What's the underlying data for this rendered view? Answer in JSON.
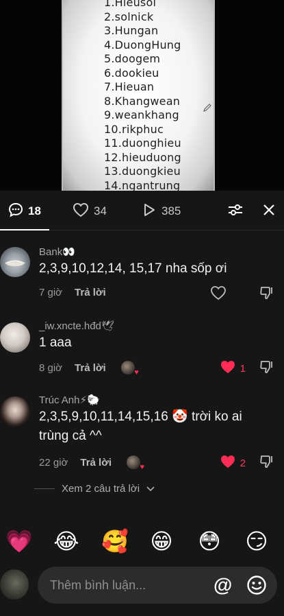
{
  "video": {
    "list_items": [
      "1.Hieusol",
      "2.solnick",
      "3.Hungan",
      "4.DuongHung",
      "5.doogem",
      "6.dookieu",
      "7.Hieuan",
      "8.Khangwean",
      "9.weankhang",
      "10.rikphuc",
      "11.duonghieu",
      "12.hieuduong",
      "13.duongkieu",
      "14.ngantrung"
    ]
  },
  "tabs": {
    "comments_count": "18",
    "likes_count": "34",
    "views_count": "385"
  },
  "comments": [
    {
      "username": "Bank👀",
      "text": "2,3,9,10,12,14, 15,17 nha sốp ơi",
      "time": "7 giờ",
      "reply_label": "Trả lời"
    },
    {
      "username": "_iw.xncte.hđd🕊",
      "text": "1 aaa",
      "time": "8 giờ",
      "reply_label": "Trả lời",
      "likes": "1"
    },
    {
      "username": "Trúc Anh⚡🐑",
      "text": "2,3,5,9,10,11,14,15,16 🤡 trời ko ai trùng cả ^^",
      "time": "22 giờ",
      "reply_label": "Trả lời",
      "likes": "2"
    }
  ],
  "view_more": "Xem 2 câu trả lời",
  "quick_emojis": [
    "💗",
    "😂",
    "🥰",
    "😁",
    "😳",
    "😏"
  ],
  "composer": {
    "placeholder": "Thêm bình luận...",
    "at_symbol": "@"
  },
  "colors": {
    "like_red": "#ff3b5c",
    "sheet_bg": "#161616",
    "input_bg": "#2c2c2c"
  }
}
